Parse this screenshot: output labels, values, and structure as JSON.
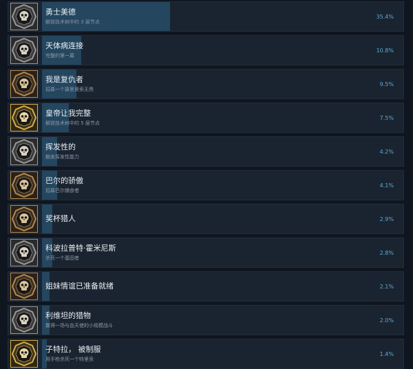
{
  "accent_bar_color": "#24465f",
  "achievements": [
    {
      "title": "勇士美德",
      "desc": "解锁技术树中的 3 层节点",
      "percent_label": "35.4%",
      "percent": 35.4,
      "badge": "silver-skull-badge-icon"
    },
    {
      "title": "天体病连接",
      "desc": "完整的第一幕",
      "percent_label": "10.8%",
      "percent": 10.8,
      "badge": "silver-skull-badge-icon"
    },
    {
      "title": "我是复仇者",
      "desc": "招募一个寡里奥索无畏",
      "percent_label": "9.5%",
      "percent": 9.5,
      "badge": "bronze-skull-badge-icon"
    },
    {
      "title": "皇帝让我完整",
      "desc": "解锁技术树中的 5 层节点",
      "percent_label": "7.5%",
      "percent": 7.5,
      "badge": "gold-skull-badge-icon"
    },
    {
      "title": "挥发性的",
      "desc": "触发挥发性能力",
      "percent_label": "4.2%",
      "percent": 4.2,
      "badge": "silver-skull-badge-icon"
    },
    {
      "title": "巴尔的骄傲",
      "desc": "招募巴尔捕食者",
      "percent_label": "4.1%",
      "percent": 4.1,
      "badge": "bronze-skull-badge-icon"
    },
    {
      "title": "奖杯猎人",
      "desc": "",
      "percent_label": "2.9%",
      "percent": 2.9,
      "badge": "bronze-skull-badge-icon"
    },
    {
      "title": "科波拉普特·霍米尼斯",
      "desc": "杀死一个基因者",
      "percent_label": "2.8%",
      "percent": 2.8,
      "badge": "silver-skull-badge-icon"
    },
    {
      "title": "姐妹情谊已准备就绪",
      "desc": "",
      "percent_label": "2.1%",
      "percent": 2.1,
      "badge": "bronze-skull-badge-icon"
    },
    {
      "title": "利维坦的猎物",
      "desc": "赢得一场与血天使的小规模战斗",
      "percent_label": "2.0%",
      "percent": 2.0,
      "badge": "silver-skull-badge-icon"
    },
    {
      "title": "子特拉， 被制服",
      "desc": "用手枪杀死一个特里贡",
      "percent_label": "1.4%",
      "percent": 1.4,
      "badge": "gold-skull-badge-icon"
    }
  ]
}
